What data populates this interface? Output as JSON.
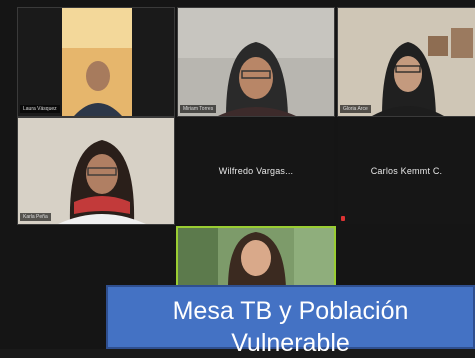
{
  "participants": [
    {
      "name": "Laura Vásquez",
      "video": true
    },
    {
      "name": "Miriam Torres",
      "video": true
    },
    {
      "name": "Gloria Arce",
      "video": true
    },
    {
      "name": "Karla Peña",
      "video": true
    },
    {
      "name": "Wilfredo Vargas...",
      "video": false
    },
    {
      "name": "Carlos Kemmt C.",
      "video": false
    },
    {
      "name": "",
      "video": true,
      "active_speaker": true
    }
  ],
  "banner": {
    "line1": "Mesa  TB y Población",
    "line2": "Vulnerable"
  },
  "colors": {
    "banner_bg": "#4472c4",
    "active_outline": "#9acd32",
    "muted_icon": "#dd3333"
  }
}
